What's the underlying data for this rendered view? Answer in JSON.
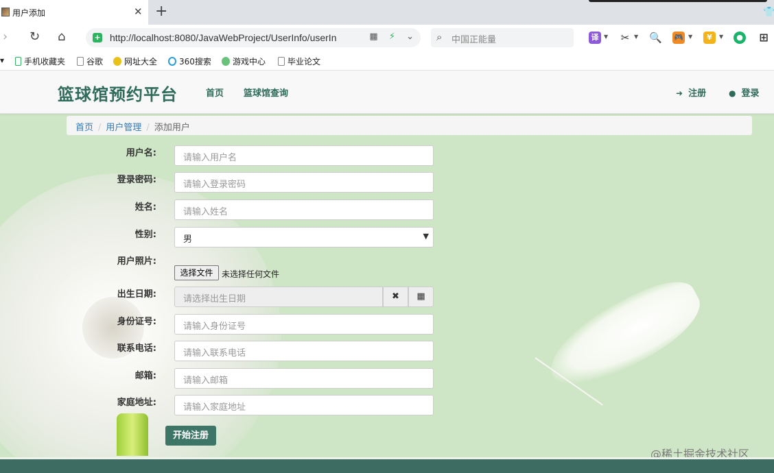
{
  "browser": {
    "tab_title": "用户添加",
    "tab_close": "✕",
    "new_tab": "+",
    "url": "http://localhost:8080/JavaWebProject/UserInfo/userIn",
    "search_placeholder": "中国正能量",
    "ext_translate_label": "译",
    "bookmarks": [
      {
        "label": "手机收藏夹",
        "icon": "phone-icon"
      },
      {
        "label": "谷歌",
        "icon": "page-icon"
      },
      {
        "label": "网址大全",
        "icon": "globe-icon"
      },
      {
        "label": "360搜索",
        "icon": "search-icon"
      },
      {
        "label": "游戏中心",
        "icon": "game-icon"
      },
      {
        "label": "毕业论文",
        "icon": "page-icon"
      }
    ]
  },
  "site": {
    "brand": "篮球馆预约平台",
    "nav": {
      "home": "首页",
      "venue_search": "篮球馆查询"
    },
    "nav_right": {
      "register": "注册",
      "login": "登录"
    }
  },
  "breadcrumb": {
    "home": "首页",
    "user_mgmt": "用户管理",
    "current": "添加用户",
    "separator": "/"
  },
  "form": {
    "username": {
      "label": "用户名:",
      "placeholder": "请输入用户名"
    },
    "password": {
      "label": "登录密码:",
      "placeholder": "请输入登录密码"
    },
    "name": {
      "label": "姓名:",
      "placeholder": "请输入姓名"
    },
    "gender": {
      "label": "性别:",
      "value": "男"
    },
    "photo": {
      "label": "用户照片:",
      "button": "选择文件",
      "status": "未选择任何文件"
    },
    "birthday": {
      "label": "出生日期:",
      "placeholder": "请选择出生日期"
    },
    "id_card": {
      "label": "身份证号:",
      "placeholder": "请输入身份证号"
    },
    "phone": {
      "label": "联系电话:",
      "placeholder": "请输入联系电话"
    },
    "email": {
      "label": "邮箱:",
      "placeholder": "请输入邮箱"
    },
    "address": {
      "label": "家庭地址:",
      "placeholder": "请输入家庭地址"
    },
    "submit": "开始注册"
  },
  "watermark": "@稀土掘金技术社区",
  "colors": {
    "accent": "#2f6b5b",
    "page_bg": "#cfe6c6",
    "button": "#3d7566",
    "link": "#337ab7"
  }
}
